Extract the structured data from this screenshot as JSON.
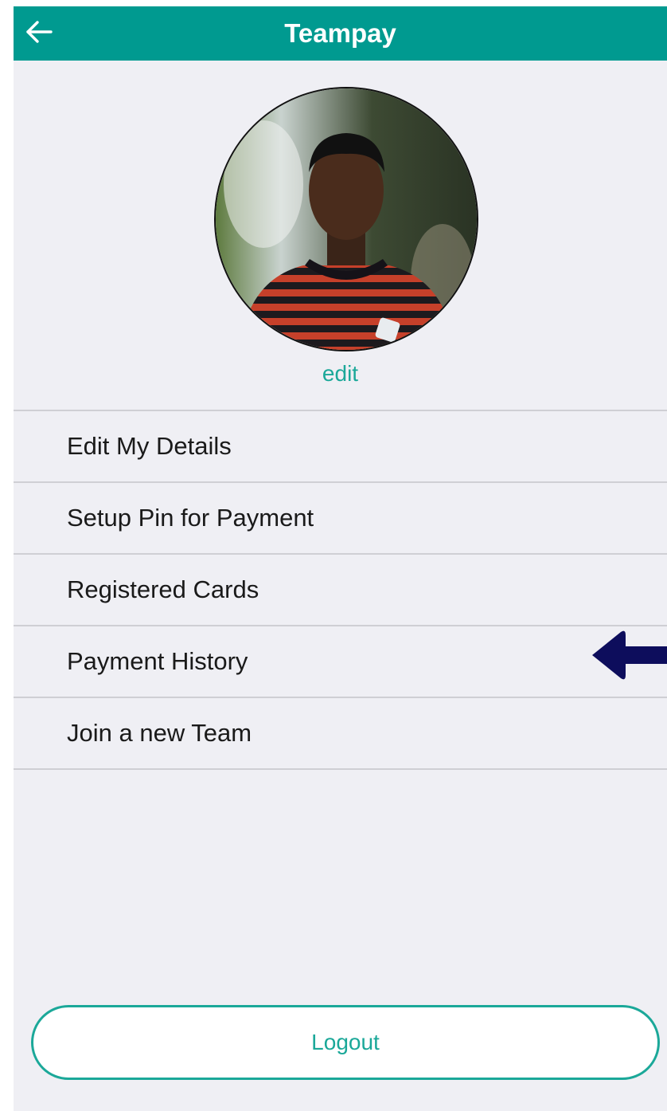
{
  "app": {
    "title": "Teampay",
    "accent_color": "#009a90",
    "link_color": "#1ba899"
  },
  "navbar": {
    "back_icon": "arrow-left-icon",
    "title": "Teampay"
  },
  "profile": {
    "avatar_alt": "profile-photo",
    "edit_label": "edit"
  },
  "menu": {
    "items": [
      {
        "label": "Edit My Details"
      },
      {
        "label": "Setup Pin for Payment"
      },
      {
        "label": "Registered Cards"
      },
      {
        "label": "Payment History"
      },
      {
        "label": "Join a new Team"
      }
    ]
  },
  "annotation": {
    "icon": "arrow-left-icon",
    "color": "#0d0d5c"
  },
  "footer": {
    "logout_label": "Logout"
  }
}
